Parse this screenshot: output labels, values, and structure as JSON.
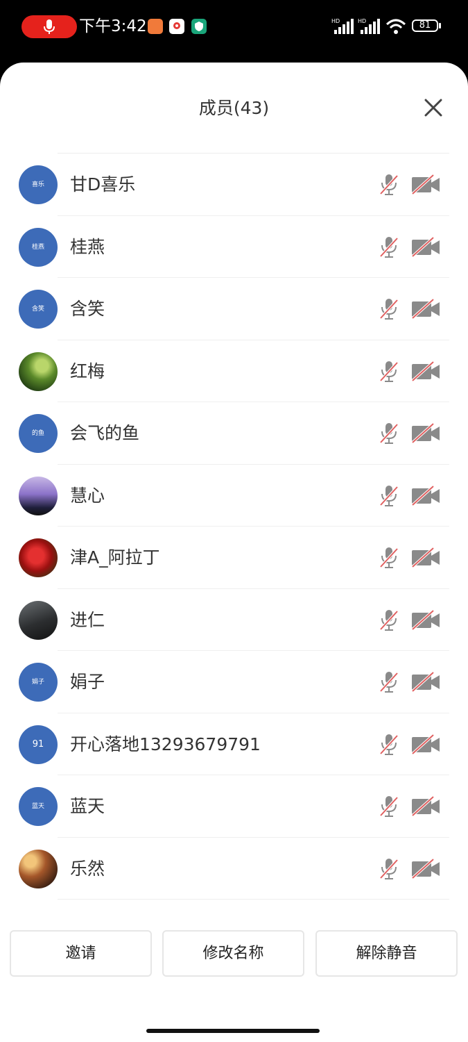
{
  "status_bar": {
    "time": "下午3:42",
    "battery": "81",
    "icons": [
      "recording-mic-icon",
      "app-icon-orange",
      "app-icon-map",
      "app-icon-shield",
      "hd-signal-icon",
      "hd-signal-icon",
      "wifi-icon",
      "battery-icon"
    ],
    "colors": {
      "recording": "#e5221c",
      "app1": "#f07a3a",
      "app2": "#ffffff",
      "app3": "#1aa57a"
    }
  },
  "sheet": {
    "title": "成员(43)",
    "close_icon": "close-icon"
  },
  "members": [
    {
      "name": "甘D喜乐",
      "avatar_text": "喜乐",
      "avatar": "text"
    },
    {
      "name": "桂燕",
      "avatar_text": "桂燕",
      "avatar": "text"
    },
    {
      "name": "含笑",
      "avatar_text": "含笑",
      "avatar": "text"
    },
    {
      "name": "红梅",
      "avatar_text": "",
      "avatar": "img-green"
    },
    {
      "name": "会飞的鱼",
      "avatar_text": "的鱼",
      "avatar": "text"
    },
    {
      "name": "慧心",
      "avatar_text": "",
      "avatar": "img-purple"
    },
    {
      "name": "津A_阿拉丁",
      "avatar_text": "",
      "avatar": "img-red"
    },
    {
      "name": "进仁",
      "avatar_text": "",
      "avatar": "img-dark"
    },
    {
      "name": "娟子",
      "avatar_text": "娟子",
      "avatar": "text"
    },
    {
      "name": "开心落地13293679791",
      "avatar_text": "91",
      "avatar": "num"
    },
    {
      "name": "蓝天",
      "avatar_text": "蓝天",
      "avatar": "text"
    },
    {
      "name": "乐然",
      "avatar_text": "",
      "avatar": "img-sunset"
    }
  ],
  "row_icons": {
    "mic": "mic-off-icon",
    "camera": "camera-off-icon"
  },
  "actions": {
    "invite": "邀请",
    "rename": "修改名称",
    "unmute": "解除静音"
  },
  "accent_colors": {
    "avatar_blue": "#3d6bb8",
    "icon_gray": "#8a8a8a",
    "icon_slash": "#e06060"
  }
}
